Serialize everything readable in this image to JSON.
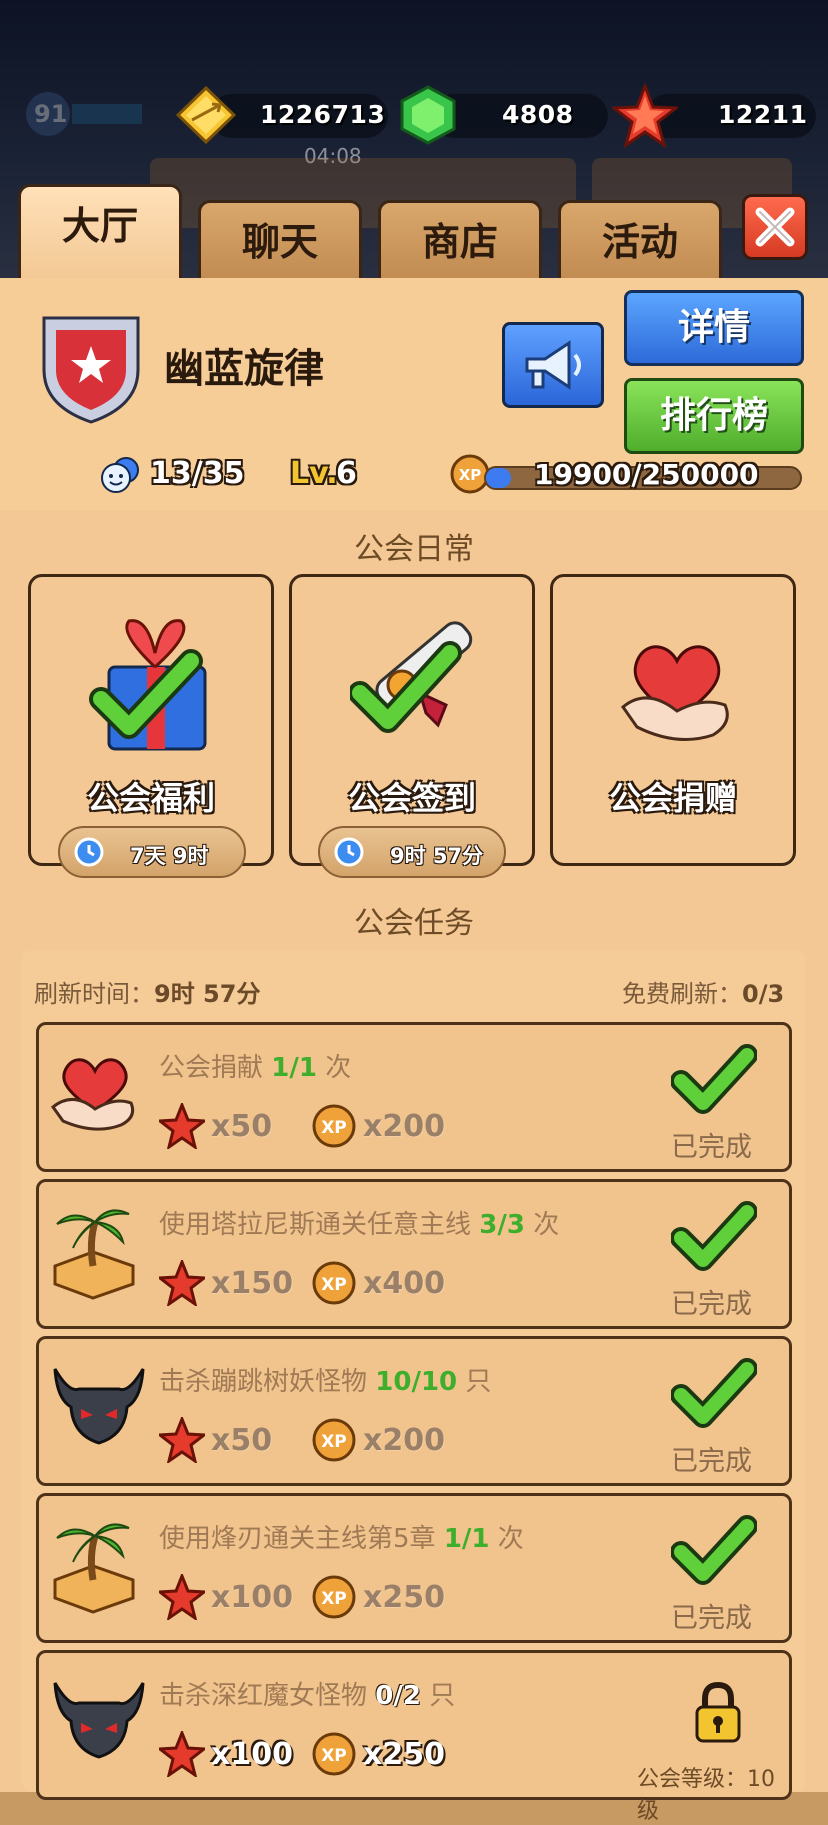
{
  "background_hud": {
    "level": "91",
    "timer": "04:08"
  },
  "resources": [
    {
      "name": "gold-arrow-icon",
      "value": "1226713"
    },
    {
      "name": "green-gem-icon",
      "value": "4808"
    },
    {
      "name": "red-star-icon",
      "value": "12211"
    }
  ],
  "tabs": [
    {
      "label": "大厅",
      "active": true
    },
    {
      "label": "聊天",
      "active": false
    },
    {
      "label": "商店",
      "active": false
    },
    {
      "label": "活动",
      "active": false
    }
  ],
  "guild": {
    "name": "幽蓝旋律",
    "details_label": "详情",
    "ranking_label": "排行榜",
    "members": "13/35",
    "level_prefix": "Lv.",
    "level": "6",
    "xp": "19900/250000",
    "xp_fraction": 0.0796
  },
  "daily": {
    "title": "公会日常",
    "cards": [
      {
        "label": "公会福利",
        "timer": "7天 9时"
      },
      {
        "label": "公会签到",
        "timer": "9时 57分"
      },
      {
        "label": "公会捐赠",
        "timer": ""
      }
    ]
  },
  "tasks": {
    "title": "公会任务",
    "refresh_label": "刷新时间：",
    "refresh_value": "9时 57分",
    "free_refresh_label": "免费刷新：",
    "free_refresh_value": "0/3",
    "items": [
      {
        "title": "公会捐献 ",
        "progress": "1/1",
        "unit": " 次",
        "stars": "x50",
        "xp": "x200",
        "status": "已完成",
        "icon": "heart-hand-icon"
      },
      {
        "title": "使用塔拉尼斯通关任意主线 ",
        "progress": "3/3",
        "unit": " 次",
        "stars": "x150",
        "xp": "x400",
        "status": "已完成",
        "icon": "palm-island-icon"
      },
      {
        "title": "击杀蹦跳树妖怪物 ",
        "progress": "10/10",
        "unit": " 只",
        "stars": "x50",
        "xp": "x200",
        "status": "已完成",
        "icon": "horned-monster-icon"
      },
      {
        "title": "使用烽刃通关主线第5章 ",
        "progress": "1/1",
        "unit": " 次",
        "stars": "x100",
        "xp": "x250",
        "status": "已完成",
        "icon": "palm-island-icon"
      },
      {
        "title": "击杀深红魔女怪物 ",
        "progress": "0/2",
        "unit": " 只",
        "stars": "x100",
        "xp": "x250",
        "status": "公会等级：10级",
        "icon": "horned-monster-icon"
      }
    ]
  },
  "colors": {
    "accent_green": "#3fae2d",
    "button_blue": "#2d6ad9",
    "button_green": "#4fae2c",
    "close_red": "#d63a22"
  }
}
